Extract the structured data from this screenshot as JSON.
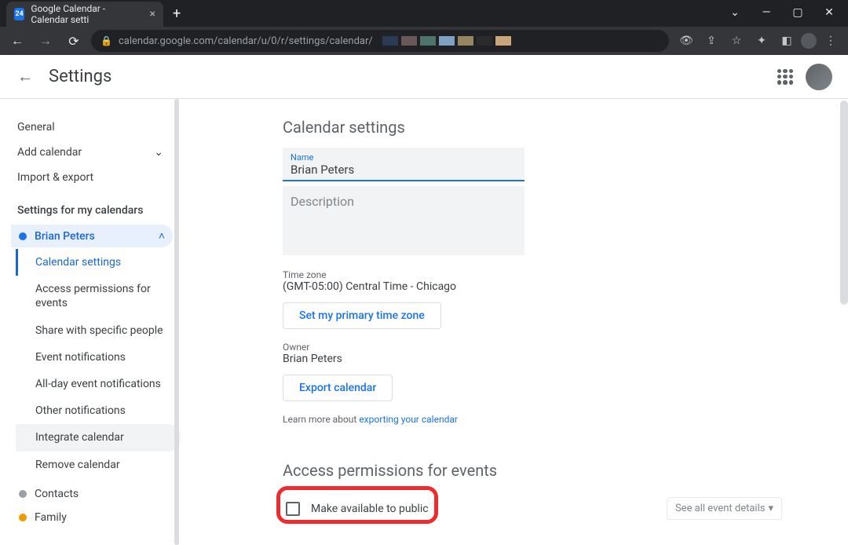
{
  "browser": {
    "tab_title": "Google Calendar - Calendar setti",
    "url": "calendar.google.com/calendar/u/0/r/settings/calendar/"
  },
  "header": {
    "title": "Settings"
  },
  "sidebar": {
    "general": "General",
    "add_calendar": "Add calendar",
    "import_export": "Import & export",
    "section_header": "Settings for my calendars",
    "selected_calendar": "Brian Peters",
    "sub_items": [
      "Calendar settings",
      "Access permissions for events",
      "Share with specific people",
      "Event notifications",
      "All-day event notifications",
      "Other notifications",
      "Integrate calendar",
      "Remove calendar"
    ],
    "other_calendars": [
      "Contacts",
      "Family"
    ]
  },
  "main": {
    "title": "Calendar settings",
    "name_label": "Name",
    "name_value": "Brian Peters",
    "description_placeholder": "Description",
    "tz_label": "Time zone",
    "tz_value": "(GMT-05:00) Central Time - Chicago",
    "tz_button": "Set my primary time zone",
    "owner_label": "Owner",
    "owner_value": "Brian Peters",
    "export_button": "Export calendar",
    "learn_prefix": "Learn more about ",
    "learn_link": "exporting your calendar",
    "perm_title": "Access permissions for events",
    "perm_checkbox_label": "Make available to public",
    "perm_dropdown": "See all event details"
  }
}
